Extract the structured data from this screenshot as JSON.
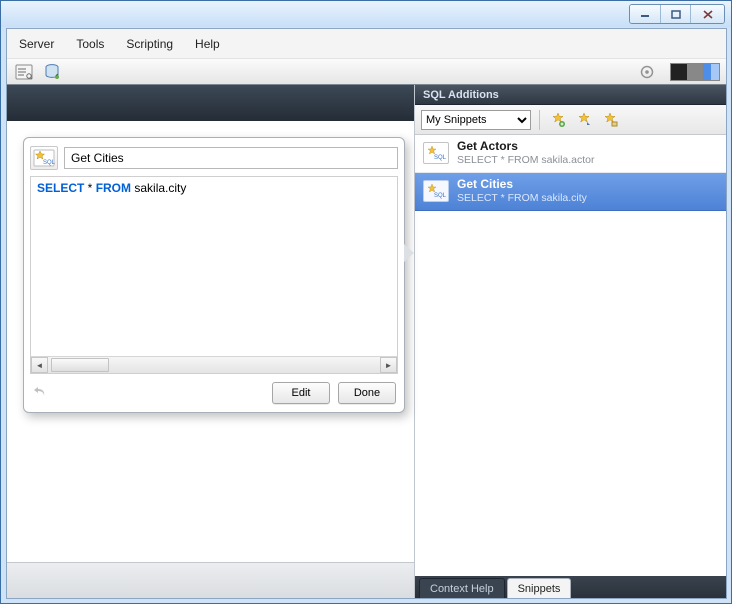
{
  "menu": {
    "server": "Server",
    "tools": "Tools",
    "scripting": "Scripting",
    "help": "Help"
  },
  "editor": {
    "name_value": "Get Cities",
    "sql_kw_select": "SELECT",
    "sql_star": " * ",
    "sql_kw_from": "FROM",
    "sql_rest": " sakila.city",
    "edit_label": "Edit",
    "done_label": "Done"
  },
  "sql_additions": {
    "title": "SQL Additions",
    "dropdown_selected": "My Snippets",
    "snippets": [
      {
        "title": "Get Actors",
        "subtitle": "SELECT * FROM sakila.actor",
        "selected": false
      },
      {
        "title": "Get Cities",
        "subtitle": "SELECT * FROM sakila.city",
        "selected": true
      }
    ],
    "tabs": {
      "context_help": "Context Help",
      "snippets": "Snippets"
    }
  },
  "icons": {
    "sql_badge_text": "SQL"
  }
}
